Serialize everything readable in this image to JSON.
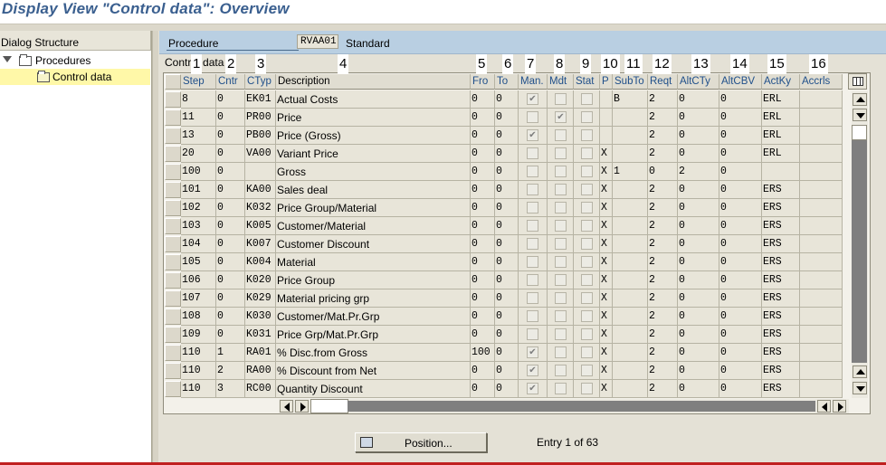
{
  "title": "Display View \"Control data\": Overview",
  "left": {
    "header": "Dialog Structure",
    "tree": [
      {
        "label": "Procedures",
        "icon": "folder-icon",
        "expanded": true
      },
      {
        "label": "Control data",
        "icon": "open-folder-icon",
        "selected": true
      }
    ]
  },
  "procedure": {
    "label": "Procedure",
    "value": "RVAA01",
    "description": "Standard"
  },
  "section_label": "Control data",
  "column_numbers": [
    "1",
    "2",
    "3",
    "4",
    "5",
    "6",
    "7",
    "8",
    "9",
    "10",
    "11",
    "12",
    "13",
    "14",
    "15",
    "16"
  ],
  "columns": [
    "Step",
    "Cntr",
    "CTyp",
    "Description",
    "Fro",
    "To",
    "Man.",
    "Mdt",
    "Stat",
    "P",
    "SubTo",
    "Reqt",
    "AltCTy",
    "AltCBV",
    "ActKy",
    "Accrls"
  ],
  "rows": [
    {
      "step": "8",
      "cntr": "0",
      "ctyp": "EK01",
      "desc": "Actual Costs",
      "fro": "0",
      "to": "0",
      "man": true,
      "mdt": false,
      "stat": false,
      "p": "",
      "subto": "B",
      "reqt": "2",
      "altcty": "0",
      "altcbv": "0",
      "actky": "ERL",
      "accrls": ""
    },
    {
      "step": "11",
      "cntr": "0",
      "ctyp": "PR00",
      "desc": "Price",
      "fro": "0",
      "to": "0",
      "man": false,
      "mdt": true,
      "stat": false,
      "p": "",
      "subto": "",
      "reqt": "2",
      "altcty": "0",
      "altcbv": "0",
      "actky": "ERL",
      "accrls": ""
    },
    {
      "step": "13",
      "cntr": "0",
      "ctyp": "PB00",
      "desc": "Price (Gross)",
      "fro": "0",
      "to": "0",
      "man": true,
      "mdt": false,
      "stat": false,
      "p": "",
      "subto": "",
      "reqt": "2",
      "altcty": "0",
      "altcbv": "0",
      "actky": "ERL",
      "accrls": ""
    },
    {
      "step": "20",
      "cntr": "0",
      "ctyp": "VA00",
      "desc": "Variant Price",
      "fro": "0",
      "to": "0",
      "man": false,
      "mdt": false,
      "stat": false,
      "p": "X",
      "subto": "",
      "reqt": "2",
      "altcty": "0",
      "altcbv": "0",
      "actky": "ERL",
      "accrls": ""
    },
    {
      "step": "100",
      "cntr": "0",
      "ctyp": "",
      "desc": "Gross",
      "fro": "0",
      "to": "0",
      "man": false,
      "mdt": false,
      "stat": false,
      "p": "X",
      "subto": "1",
      "reqt": "0",
      "altcty": "2",
      "altcbv": "0",
      "actky": "",
      "accrls": ""
    },
    {
      "step": "101",
      "cntr": "0",
      "ctyp": "KA00",
      "desc": "Sales deal",
      "fro": "0",
      "to": "0",
      "man": false,
      "mdt": false,
      "stat": false,
      "p": "X",
      "subto": "",
      "reqt": "2",
      "altcty": "0",
      "altcbv": "0",
      "actky": "ERS",
      "accrls": ""
    },
    {
      "step": "102",
      "cntr": "0",
      "ctyp": "K032",
      "desc": "Price Group/Material",
      "fro": "0",
      "to": "0",
      "man": false,
      "mdt": false,
      "stat": false,
      "p": "X",
      "subto": "",
      "reqt": "2",
      "altcty": "0",
      "altcbv": "0",
      "actky": "ERS",
      "accrls": ""
    },
    {
      "step": "103",
      "cntr": "0",
      "ctyp": "K005",
      "desc": "Customer/Material",
      "fro": "0",
      "to": "0",
      "man": false,
      "mdt": false,
      "stat": false,
      "p": "X",
      "subto": "",
      "reqt": "2",
      "altcty": "0",
      "altcbv": "0",
      "actky": "ERS",
      "accrls": ""
    },
    {
      "step": "104",
      "cntr": "0",
      "ctyp": "K007",
      "desc": "Customer Discount",
      "fro": "0",
      "to": "0",
      "man": false,
      "mdt": false,
      "stat": false,
      "p": "X",
      "subto": "",
      "reqt": "2",
      "altcty": "0",
      "altcbv": "0",
      "actky": "ERS",
      "accrls": ""
    },
    {
      "step": "105",
      "cntr": "0",
      "ctyp": "K004",
      "desc": "Material",
      "fro": "0",
      "to": "0",
      "man": false,
      "mdt": false,
      "stat": false,
      "p": "X",
      "subto": "",
      "reqt": "2",
      "altcty": "0",
      "altcbv": "0",
      "actky": "ERS",
      "accrls": ""
    },
    {
      "step": "106",
      "cntr": "0",
      "ctyp": "K020",
      "desc": "Price Group",
      "fro": "0",
      "to": "0",
      "man": false,
      "mdt": false,
      "stat": false,
      "p": "X",
      "subto": "",
      "reqt": "2",
      "altcty": "0",
      "altcbv": "0",
      "actky": "ERS",
      "accrls": ""
    },
    {
      "step": "107",
      "cntr": "0",
      "ctyp": "K029",
      "desc": "Material pricing grp",
      "fro": "0",
      "to": "0",
      "man": false,
      "mdt": false,
      "stat": false,
      "p": "X",
      "subto": "",
      "reqt": "2",
      "altcty": "0",
      "altcbv": "0",
      "actky": "ERS",
      "accrls": ""
    },
    {
      "step": "108",
      "cntr": "0",
      "ctyp": "K030",
      "desc": "Customer/Mat.Pr.Grp",
      "fro": "0",
      "to": "0",
      "man": false,
      "mdt": false,
      "stat": false,
      "p": "X",
      "subto": "",
      "reqt": "2",
      "altcty": "0",
      "altcbv": "0",
      "actky": "ERS",
      "accrls": ""
    },
    {
      "step": "109",
      "cntr": "0",
      "ctyp": "K031",
      "desc": "Price Grp/Mat.Pr.Grp",
      "fro": "0",
      "to": "0",
      "man": false,
      "mdt": false,
      "stat": false,
      "p": "X",
      "subto": "",
      "reqt": "2",
      "altcty": "0",
      "altcbv": "0",
      "actky": "ERS",
      "accrls": ""
    },
    {
      "step": "110",
      "cntr": "1",
      "ctyp": "RA01",
      "desc": "% Disc.from Gross",
      "fro": "100",
      "to": "0",
      "man": true,
      "mdt": false,
      "stat": false,
      "p": "X",
      "subto": "",
      "reqt": "2",
      "altcty": "0",
      "altcbv": "0",
      "actky": "ERS",
      "accrls": ""
    },
    {
      "step": "110",
      "cntr": "2",
      "ctyp": "RA00",
      "desc": "% Discount from Net",
      "fro": "0",
      "to": "0",
      "man": true,
      "mdt": false,
      "stat": false,
      "p": "X",
      "subto": "",
      "reqt": "2",
      "altcty": "0",
      "altcbv": "0",
      "actky": "ERS",
      "accrls": ""
    },
    {
      "step": "110",
      "cntr": "3",
      "ctyp": "RC00",
      "desc": "Quantity Discount",
      "fro": "0",
      "to": "0",
      "man": true,
      "mdt": false,
      "stat": false,
      "p": "X",
      "subto": "",
      "reqt": "2",
      "altcty": "0",
      "altcbv": "0",
      "actky": "ERS",
      "accrls": ""
    }
  ],
  "position_button": "Position...",
  "entry_info": "Entry 1 of 63"
}
